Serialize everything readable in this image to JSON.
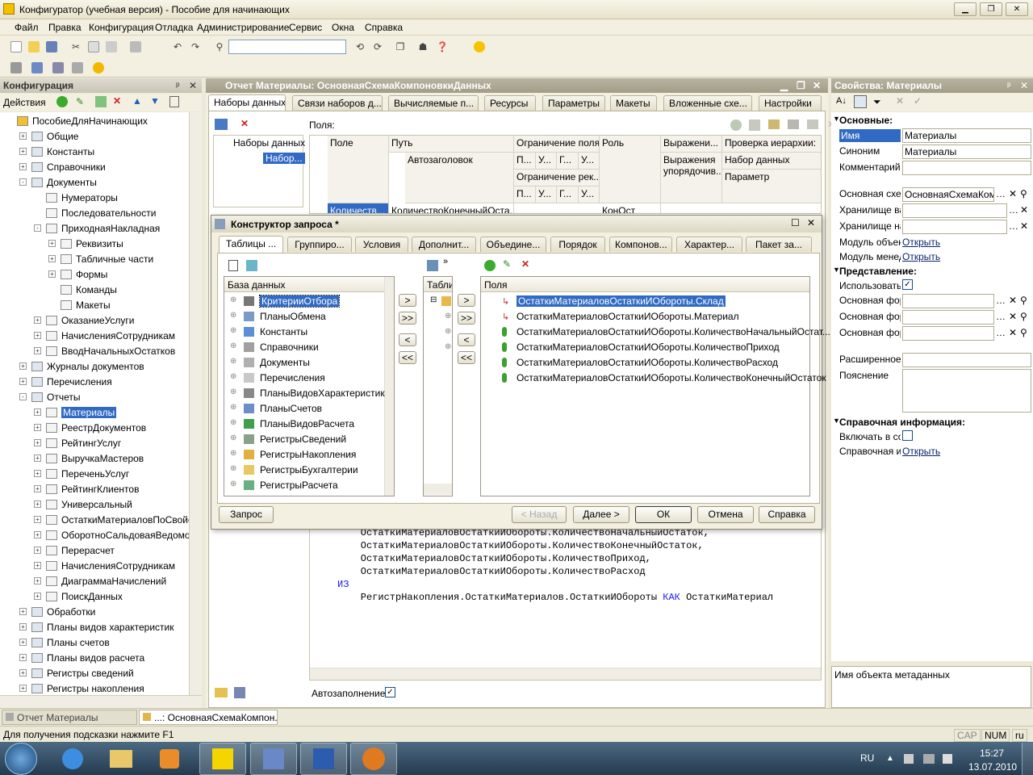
{
  "window": {
    "title": "Конфигуратор (учебная версия) - Пособие для начинающих"
  },
  "menu": [
    "Файл",
    "Правка",
    "Конфигурация",
    "Отладка",
    "Администрирование",
    "Сервис",
    "Окна",
    "Справка"
  ],
  "config_panel": {
    "title": "Конфигурация",
    "actions_label": "Действия",
    "tree": [
      {
        "label": "ПособиеДляНачинающих",
        "level": 0,
        "sign": ""
      },
      {
        "label": "Общие",
        "level": 1,
        "sign": "+"
      },
      {
        "label": "Константы",
        "level": 1,
        "sign": "+"
      },
      {
        "label": "Справочники",
        "level": 1,
        "sign": "+"
      },
      {
        "label": "Документы",
        "level": 1,
        "sign": "-"
      },
      {
        "label": "Нумераторы",
        "level": 2,
        "sign": ""
      },
      {
        "label": "Последовательности",
        "level": 2,
        "sign": ""
      },
      {
        "label": "ПриходнаяНакладная",
        "level": 2,
        "sign": "-"
      },
      {
        "label": "Реквизиты",
        "level": 3,
        "sign": "+"
      },
      {
        "label": "Табличные части",
        "level": 3,
        "sign": "+"
      },
      {
        "label": "Формы",
        "level": 3,
        "sign": "+"
      },
      {
        "label": "Команды",
        "level": 3,
        "sign": ""
      },
      {
        "label": "Макеты",
        "level": 3,
        "sign": ""
      },
      {
        "label": "ОказаниеУслуги",
        "level": 2,
        "sign": "+"
      },
      {
        "label": "НачисленияСотрудникам",
        "level": 2,
        "sign": "+"
      },
      {
        "label": "ВводНачальныхОстатков",
        "level": 2,
        "sign": "+"
      },
      {
        "label": "Журналы документов",
        "level": 1,
        "sign": "+"
      },
      {
        "label": "Перечисления",
        "level": 1,
        "sign": "+"
      },
      {
        "label": "Отчеты",
        "level": 1,
        "sign": "-"
      },
      {
        "label": "Материалы",
        "level": 2,
        "sign": "+",
        "selected": true
      },
      {
        "label": "РеестрДокументов",
        "level": 2,
        "sign": "+"
      },
      {
        "label": "РейтингУслуг",
        "level": 2,
        "sign": "+"
      },
      {
        "label": "ВыручкаМастеров",
        "level": 2,
        "sign": "+"
      },
      {
        "label": "ПереченьУслуг",
        "level": 2,
        "sign": "+"
      },
      {
        "label": "РейтингКлиентов",
        "level": 2,
        "sign": "+"
      },
      {
        "label": "Универсальный",
        "level": 2,
        "sign": "+"
      },
      {
        "label": "ОстаткиМатериаловПоСвойств...",
        "level": 2,
        "sign": "+"
      },
      {
        "label": "ОборотноСальдоваяВедомость",
        "level": 2,
        "sign": "+"
      },
      {
        "label": "Перерасчет",
        "level": 2,
        "sign": "+"
      },
      {
        "label": "НачисленияСотрудникам",
        "level": 2,
        "sign": "+"
      },
      {
        "label": "ДиаграммаНачислений",
        "level": 2,
        "sign": "+"
      },
      {
        "label": "ПоискДанных",
        "level": 2,
        "sign": "+"
      },
      {
        "label": "Обработки",
        "level": 1,
        "sign": "+"
      },
      {
        "label": "Планы видов характеристик",
        "level": 1,
        "sign": "+"
      },
      {
        "label": "Планы счетов",
        "level": 1,
        "sign": "+"
      },
      {
        "label": "Планы видов расчета",
        "level": 1,
        "sign": "+"
      },
      {
        "label": "Регистры сведений",
        "level": 1,
        "sign": "+"
      },
      {
        "label": "Регистры накопления",
        "level": 1,
        "sign": "+"
      }
    ]
  },
  "report_window": {
    "title": "Отчет Материалы: ОсновнаяСхемаКомпоновкиДанных",
    "tabs": [
      "Наборы данных",
      "Связи наборов д...",
      "Вычисляемые п...",
      "Ресурсы",
      "Параметры",
      "Макеты",
      "Вложенные схе...",
      "Настройки"
    ],
    "datasets_root": "Наборы данных",
    "dataset_item": "Набор...",
    "fields_label": "Поля:",
    "grid_headers": {
      "field": "Поле",
      "path": "Путь",
      "restriction": "Ограничение поля",
      "role": "Роль",
      "expressions": "Выражени...",
      "hier_check": "Проверка иерархии:"
    },
    "grid_sub": {
      "autotitle": "Автозаголовок",
      "p": "П...",
      "u": "У...",
      "g": "Г...",
      "restriction_req": "Ограничение рек...",
      "order_expr": "Выражения упорядочив...",
      "dataset": "Набор данных",
      "param": "Параметр"
    },
    "grid_row": {
      "field": "Количеств...",
      "path": "КоличествоКонечныйОста...",
      "role": "КонОст"
    },
    "code_lines": [
      "    ОстаткиМатериаловОстаткиИОбороты.КоличествоНачальныйОстаток,",
      "    ОстаткиМатериаловОстаткиИОбороты.КоличествоКонечныйОстаток,",
      "    ОстаткиМатериаловОстаткиИОбороты.КоличествоПриход,",
      "    ОстаткиМатериаловОстаткиИОбороты.КоличествоРасход"
    ],
    "code_kw_iz": "ИЗ",
    "code_from": "    РегистрНакопления.ОстаткиМатериалов.ОстаткиИОбороты ",
    "code_kw_kak": "КАК",
    "code_alias": " ОстаткиМатериал",
    "autofill_label": "Автозаполнение"
  },
  "query_dialog": {
    "title": "Конструктор запроса *",
    "tabs": [
      "Таблицы ...",
      "Группиро...",
      "Условия",
      "Дополнит...",
      "Объедине...",
      "Порядок",
      "Компонов...",
      "Характер...",
      "Пакет за..."
    ],
    "db_header": "База данных",
    "db_items": [
      "КритерииОтбора",
      "ПланыОбмена",
      "Константы",
      "Справочники",
      "Документы",
      "Перечисления",
      "ПланыВидовХарактеристик",
      "ПланыСчетов",
      "ПланыВидовРасчета",
      "РегистрыСведений",
      "РегистрыНакопления",
      "РегистрыБухгалтерии",
      "РегистрыРасчета"
    ],
    "tables_header": "Табли",
    "fields_header": "Поля",
    "fields": [
      "ОстаткиМатериаловОстаткиИОбороты.Склад",
      "ОстаткиМатериаловОстаткиИОбороты.Материал",
      "ОстаткиМатериаловОстаткиИОбороты.КоличествоНачальныйОстат...",
      "ОстаткиМатериаловОстаткиИОбороты.КоличествоПриход",
      "ОстаткиМатериаловОстаткиИОбороты.КоличествоРасход",
      "ОстаткиМатериаловОстаткиИОбороты.КоличествоКонечныйОстаток"
    ],
    "arrows": [
      ">",
      ">>",
      "<",
      "<<"
    ],
    "buttons": {
      "query": "Запрос",
      "back": "< Назад",
      "next": "Далее >",
      "ok": "ОК",
      "cancel": "Отмена",
      "help": "Справка"
    }
  },
  "properties": {
    "title": "Свойства: Материалы",
    "section_main": "Основные:",
    "name_label": "Имя",
    "name_value": "Материалы",
    "synonym_label": "Синоним",
    "synonym_value": "Материалы",
    "comment_label": "Комментарий",
    "main_scheme_label": "Основная схем",
    "main_scheme_value": "ОсновнаяСхемаКомп",
    "storage1_label": "Хранилище вар",
    "storage2_label": "Хранилище нас",
    "object_module_label": "Модуль объект",
    "open_link": "Открыть",
    "manager_module_label": "Модуль менед",
    "section_view": "Представление:",
    "use_label": "Использовать",
    "form1_label": "Основная форм",
    "form2_label": "Основная форм",
    "form3_label": "Основная форм",
    "ext_label": "Расширенное п",
    "explanation_label": "Пояснение",
    "section_help": "Справочная информация:",
    "include_label": "Включать в сод",
    "help_label": "Справочная ин",
    "footer_hint": "Имя объекта метаданных"
  },
  "window_tabs": [
    "Отчет Материалы",
    "...: ОсновнаяСхемаКомпон..."
  ],
  "status": {
    "hint": "Для получения подсказки нажмите F1",
    "cap": "CAP",
    "num": "NUM",
    "lang": "ru"
  },
  "taskbar": {
    "lang": "RU",
    "time": "15:27",
    "date": "13.07.2010"
  }
}
